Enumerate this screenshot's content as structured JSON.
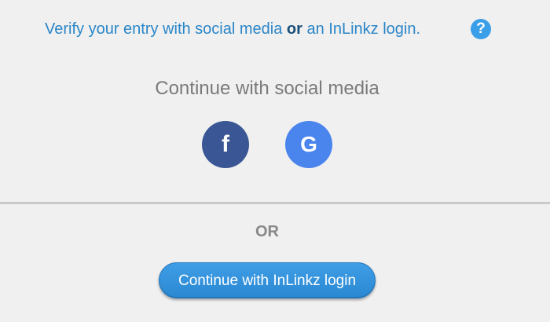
{
  "verify": {
    "prefix": "Verify your entry with social media ",
    "or_word": "or",
    "suffix": " an InLinkz login.",
    "help_icon": "?"
  },
  "social": {
    "title": "Continue with social media",
    "facebook_glyph": "f",
    "google_glyph": "G"
  },
  "divider_label": "OR",
  "login_button_label": "Continue with InLinkz login",
  "colors": {
    "accent": "#2a86c8",
    "facebook": "#3b5694",
    "google": "#4a84ed",
    "background": "#f0f0f0"
  }
}
